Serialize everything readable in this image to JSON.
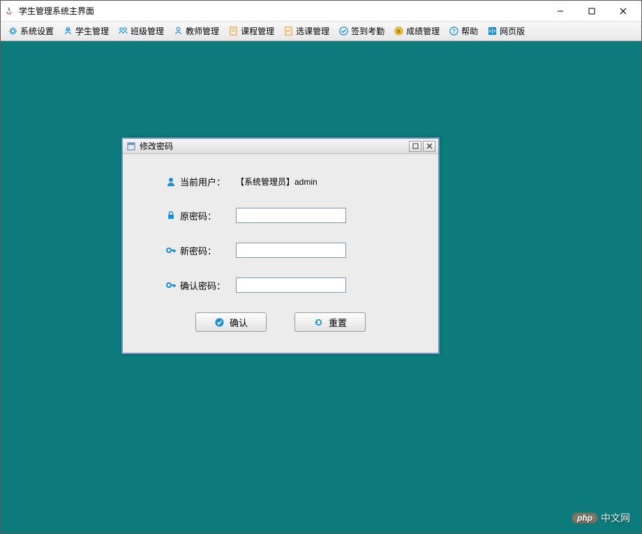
{
  "window": {
    "title": "学生管理系统主界面"
  },
  "toolbar": {
    "items": [
      {
        "label": "系统设置",
        "icon": "gear"
      },
      {
        "label": "学生管理",
        "icon": "student"
      },
      {
        "label": "班级管理",
        "icon": "class"
      },
      {
        "label": "教师管理",
        "icon": "teacher"
      },
      {
        "label": "课程管理",
        "icon": "course"
      },
      {
        "label": "选课管理",
        "icon": "select"
      },
      {
        "label": "签到考勤",
        "icon": "checkin"
      },
      {
        "label": "成绩管理",
        "icon": "grade"
      },
      {
        "label": "帮助",
        "icon": "help"
      },
      {
        "label": "网页版",
        "icon": "web"
      }
    ]
  },
  "dialog": {
    "title": "修改密码",
    "current_user_label": "当前用户：",
    "current_user_value": "【系统管理员】admin",
    "old_password_label": "原密码：",
    "new_password_label": "新密码：",
    "confirm_password_label": "确认密码：",
    "confirm_button": "确认",
    "reset_button": "重置"
  },
  "watermark": {
    "php": "php",
    "text": "中文网"
  },
  "colors": {
    "content_bg": "#0d7b7b",
    "dialog_border": "#6a93c2",
    "icon_blue": "#1b8fd6",
    "icon_orange": "#f2a236"
  }
}
